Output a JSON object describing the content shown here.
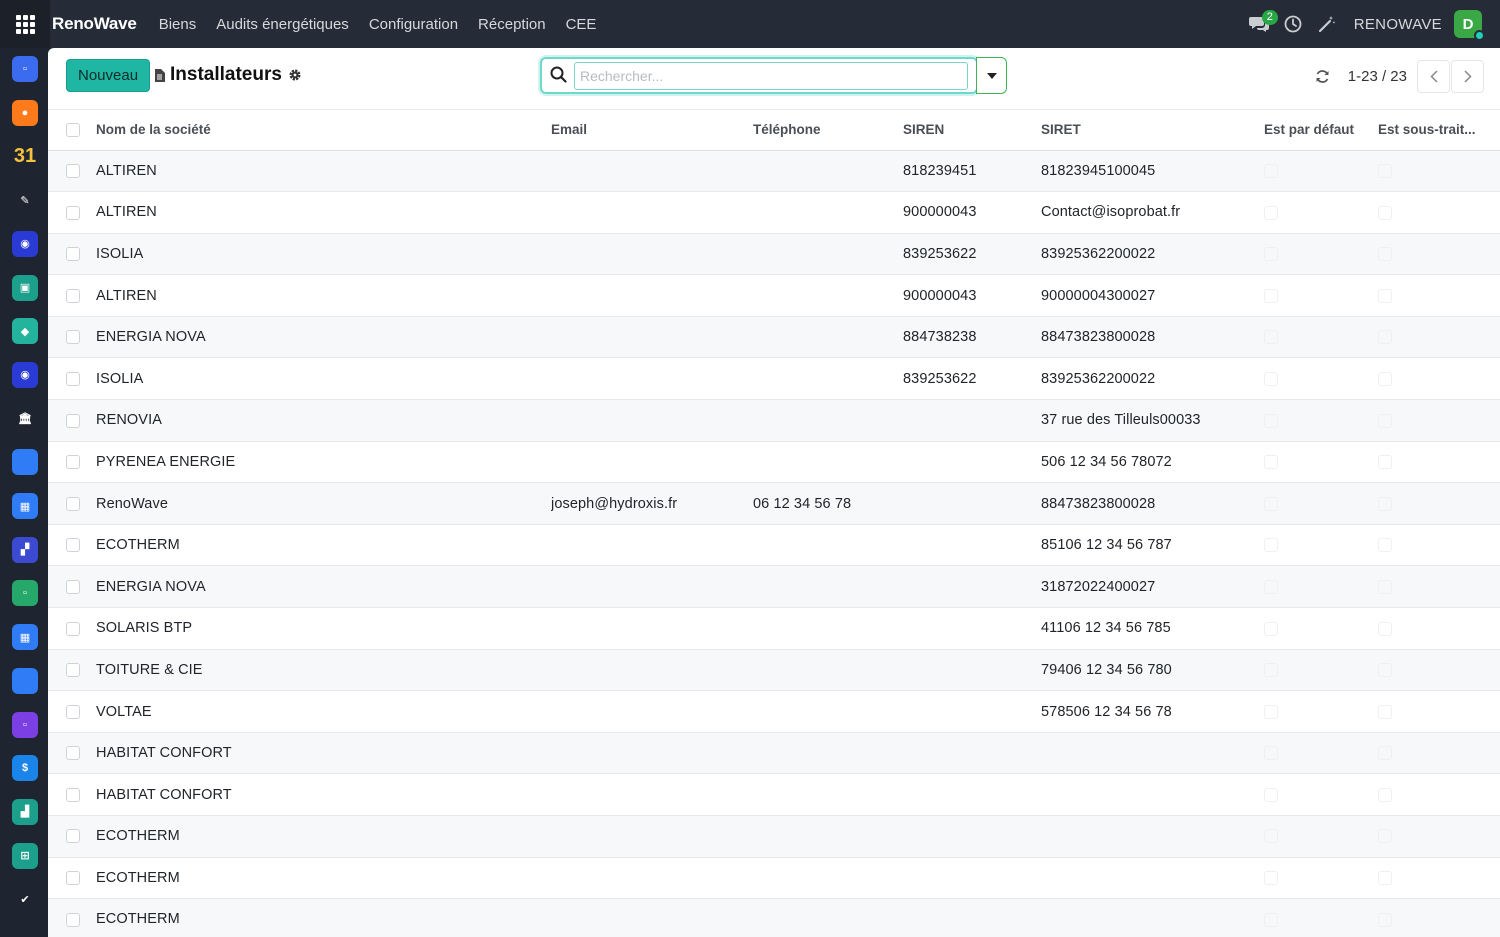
{
  "app": {
    "brand": "RenoWave",
    "menu": [
      "Biens",
      "Audits énergétiques",
      "Configuration",
      "Réception",
      "CEE"
    ],
    "chat_count": "2",
    "company": "RENOWAVE",
    "user_initial": "D"
  },
  "sidebar": {
    "icons": [
      {
        "name": "app-icon-1",
        "color": "#3b6cf0",
        "glyph": "▫"
      },
      {
        "name": "app-icon-discuss",
        "color": "#ff7a1a",
        "glyph": "●"
      },
      {
        "name": "app-icon-calendar",
        "color": "#1f2530",
        "glyph": "31"
      },
      {
        "name": "app-icon-sign",
        "color": "#1f2530",
        "glyph": "✎"
      },
      {
        "name": "app-icon-4",
        "color": "#2a3ad4",
        "glyph": "◉"
      },
      {
        "name": "app-icon-contacts",
        "color": "#1ca08c",
        "glyph": "▣"
      },
      {
        "name": "app-icon-6",
        "color": "#24b49e",
        "glyph": "◆"
      },
      {
        "name": "app-icon-7",
        "color": "#2a3ad4",
        "glyph": "◉"
      },
      {
        "name": "app-icon-bank",
        "color": "#1f2530",
        "glyph": "🏛"
      },
      {
        "name": "app-icon-9",
        "color": "#2f7cf6",
        "glyph": ""
      },
      {
        "name": "app-icon-planning",
        "color": "#2f7cf6",
        "glyph": "▦"
      },
      {
        "name": "app-icon-dashboard",
        "color": "#3b4ad0",
        "glyph": "▞"
      },
      {
        "name": "app-icon-12",
        "color": "#27a86b",
        "glyph": "▫"
      },
      {
        "name": "app-icon-agenda",
        "color": "#2f7cf6",
        "glyph": "▦"
      },
      {
        "name": "app-icon-14",
        "color": "#2f7cf6",
        "glyph": ""
      },
      {
        "name": "app-icon-15",
        "color": "#7b3fe4",
        "glyph": "▫"
      },
      {
        "name": "app-icon-16",
        "color": "#1b84e8",
        "glyph": "$"
      },
      {
        "name": "app-icon-17",
        "color": "#1ca08c",
        "glyph": "▟"
      },
      {
        "name": "app-icon-18",
        "color": "#1ca08c",
        "glyph": "⊞"
      },
      {
        "name": "app-icon-19",
        "color": "#1f2530",
        "glyph": "✔"
      }
    ]
  },
  "control": {
    "new_label": "Nouveau",
    "title": "Installateurs",
    "search_placeholder": "Rechercher...",
    "pager": "1-23 / 23"
  },
  "table": {
    "headers": [
      "Nom de la société",
      "Email",
      "Téléphone",
      "SIREN",
      "SIRET",
      "Est par défaut",
      "Est sous-trait..."
    ],
    "rows": [
      {
        "name": "ALTIREN",
        "email": "",
        "phone": "",
        "siren": "818239451",
        "siret": "81823945100045"
      },
      {
        "name": "ALTIREN",
        "email": "",
        "phone": "",
        "siren": "900000043",
        "siret": "Contact@isoprobat.fr"
      },
      {
        "name": "ISOLIA",
        "email": "",
        "phone": "",
        "siren": "839253622",
        "siret": "83925362200022"
      },
      {
        "name": "ALTIREN",
        "email": "",
        "phone": "",
        "siren": "900000043",
        "siret": "90000004300027"
      },
      {
        "name": "ENERGIA NOVA",
        "email": "",
        "phone": "",
        "siren": "884738238",
        "siret": "88473823800028"
      },
      {
        "name": "ISOLIA",
        "email": "",
        "phone": "",
        "siren": "839253622",
        "siret": "83925362200022"
      },
      {
        "name": "RENOVIA",
        "email": "",
        "phone": "",
        "siren": "",
        "siret": "37 rue des Tilleuls00033"
      },
      {
        "name": "PYRENEA ENERGIE",
        "email": "",
        "phone": "",
        "siren": "",
        "siret": "506 12 34 56 78072"
      },
      {
        "name": "RenoWave",
        "email": "joseph@hydroxis.fr",
        "phone": "06 12 34 56 78",
        "siren": "",
        "siret": "88473823800028"
      },
      {
        "name": "ECOTHERM",
        "email": "",
        "phone": "",
        "siren": "",
        "siret": "85106 12 34 56 787"
      },
      {
        "name": "ENERGIA NOVA",
        "email": "",
        "phone": "",
        "siren": "",
        "siret": "31872022400027"
      },
      {
        "name": "SOLARIS BTP",
        "email": "",
        "phone": "",
        "siren": "",
        "siret": "41106 12 34 56 785"
      },
      {
        "name": "TOITURE & CIE",
        "email": "",
        "phone": "",
        "siren": "",
        "siret": "79406 12 34 56 780"
      },
      {
        "name": "VOLTAE",
        "email": "",
        "phone": "",
        "siren": "",
        "siret": "578506 12 34 56 78"
      },
      {
        "name": "HABITAT CONFORT",
        "email": "",
        "phone": "",
        "siren": "",
        "siret": ""
      },
      {
        "name": "HABITAT CONFORT",
        "email": "",
        "phone": "",
        "siren": "",
        "siret": ""
      },
      {
        "name": "ECOTHERM",
        "email": "",
        "phone": "",
        "siren": "",
        "siret": ""
      },
      {
        "name": "ECOTHERM",
        "email": "",
        "phone": "",
        "siren": "",
        "siret": ""
      },
      {
        "name": "ECOTHERM",
        "email": "",
        "phone": "",
        "siren": "",
        "siret": ""
      }
    ]
  }
}
